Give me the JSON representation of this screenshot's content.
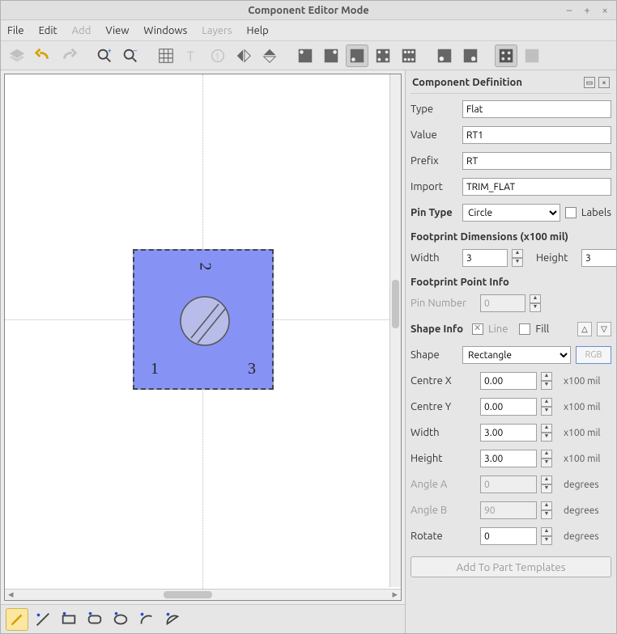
{
  "window": {
    "title": "Component Editor Mode"
  },
  "menu": {
    "file": "File",
    "edit": "Edit",
    "add": "Add",
    "view": "View",
    "windows": "Windows",
    "layers": "Layers",
    "help": "Help"
  },
  "panel": {
    "header": "Component Definition",
    "type_label": "Type",
    "type_value": "Flat",
    "value_label": "Value",
    "value_value": "RT1",
    "prefix_label": "Prefix",
    "prefix_value": "RT",
    "import_label": "Import",
    "import_value": "TRIM_FLAT",
    "pintype_label": "Pin Type",
    "pintype_value": "Circle",
    "labels_label": "Labels",
    "dim_header": "Footprint Dimensions (x100 mil)",
    "width_label": "Width",
    "width_value": "3",
    "height_label": "Height",
    "height_value": "3",
    "point_header": "Footprint Point Info",
    "pinnum_label": "Pin Number",
    "pinnum_value": "0",
    "shapeinfo_label": "Shape Info",
    "line_label": "Line",
    "fill_label": "Fill",
    "shape_label": "Shape",
    "shape_value": "Rectangle",
    "rgb_label": "RGB",
    "cx_label": "Centre X",
    "cx_value": "0.00",
    "cy_label": "Centre Y",
    "cy_value": "0.00",
    "sw_label": "Width",
    "sw_value": "3.00",
    "sh_label": "Height",
    "sh_value": "3.00",
    "aa_label": "Angle A",
    "aa_value": "0",
    "ab_label": "Angle B",
    "ab_value": "90",
    "rot_label": "Rotate",
    "rot_value": "0",
    "unit_mil": "x100 mil",
    "unit_deg": "degrees",
    "addbtn": "Add To Part Templates"
  },
  "canvas": {
    "pin1": "1",
    "pin2": "2",
    "pin3": "3"
  }
}
